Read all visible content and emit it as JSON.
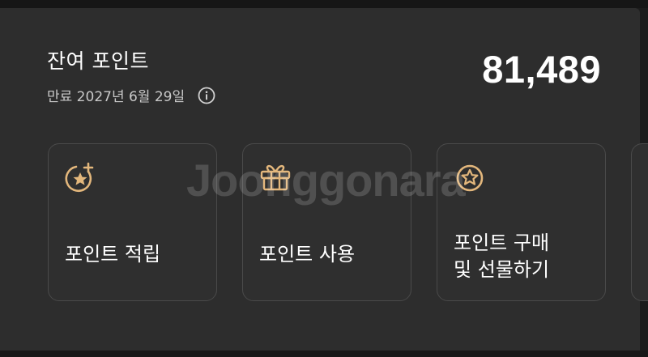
{
  "balance": {
    "title": "잔여 포인트",
    "expiry": "만료 2027년 6월 29일",
    "points": "81,489"
  },
  "actions": [
    {
      "label": "포인트 적립",
      "icon": "star-plus-icon"
    },
    {
      "label": "포인트 사용",
      "icon": "gift-icon"
    },
    {
      "label": "포인트 구매\n및 선물하기",
      "icon": "star-circle-icon"
    }
  ],
  "watermark": "Joonggonara",
  "colors": {
    "accent": "#e3b77c",
    "panel": "#2d2d2d",
    "card": "#2f2f2f"
  }
}
